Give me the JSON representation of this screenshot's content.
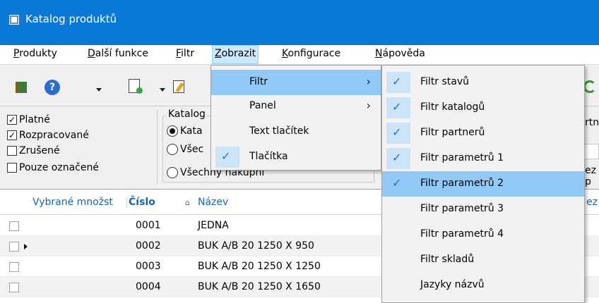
{
  "window": {
    "title": "Katalog produktů"
  },
  "menubar": {
    "items": [
      {
        "label": "Produkty",
        "accel": "P",
        "rest": "rodukty"
      },
      {
        "label": "Další funkce",
        "accel": "D",
        "rest": "alší funkce"
      },
      {
        "label": "Filtr",
        "accel": "F",
        "rest": "iltr"
      },
      {
        "label": "Zobrazit",
        "accel": "Z",
        "rest": "obrazit"
      },
      {
        "label": "Konfigurace",
        "accel": "K",
        "rest": "onfigurace"
      },
      {
        "label": "Nápověda",
        "accel": "N",
        "rest": "ápověda"
      }
    ],
    "active": "Zobrazit"
  },
  "toolbar": {
    "icons": [
      "exit-icon",
      "help-icon",
      "new-document-icon",
      "edit-document-icon",
      "refresh-icon"
    ],
    "help_glyph": "?"
  },
  "states_filter": {
    "items": [
      {
        "label": "Platné",
        "checked": true
      },
      {
        "label": "Rozpracované",
        "checked": true
      },
      {
        "label": "Zrušené",
        "checked": false
      },
      {
        "label": "Pouze označené",
        "checked": false
      }
    ],
    "check_glyph": "✓"
  },
  "catalog_filter": {
    "legend": "Katalog",
    "options": [
      {
        "label": "Kata",
        "selected": true
      },
      {
        "label": "Všec",
        "selected": false
      },
      {
        "label": "Všechny nákupní",
        "selected": false
      }
    ]
  },
  "right_panel": {
    "partner_fragment": "rtn",
    "ez_fragment": "ez p"
  },
  "grid": {
    "headers": {
      "selected_qty": "Vybrané množst",
      "number": "Číslo",
      "sort_glyph": "⌂",
      "name": "Název",
      "right_fragment": "ez"
    },
    "rows": [
      {
        "number": "0001",
        "name": "JEDNA",
        "current": false
      },
      {
        "number": "0002",
        "name": "BUK A/B 20 1250 X 950",
        "current": true
      },
      {
        "number": "0003",
        "name": "BUK A/B 20 1250 X 1250",
        "current": false
      },
      {
        "number": "0004",
        "name": "BUK A/B 20 1250 X 1650",
        "current": false
      }
    ]
  },
  "zobrazit_menu": {
    "items": [
      {
        "label": "Filtr",
        "submenu": true,
        "checked": false,
        "highlighted": true
      },
      {
        "label": "Panel",
        "submenu": true,
        "checked": false,
        "highlighted": false
      },
      {
        "label": "Text tlačítek",
        "submenu": false,
        "checked": false,
        "highlighted": false
      },
      {
        "label": "Tlačítka",
        "submenu": false,
        "checked": true,
        "highlighted": false
      }
    ],
    "chevron_glyph": "›"
  },
  "filtr_submenu": {
    "items": [
      {
        "label": "Filtr stavů",
        "checked": true,
        "highlighted": false
      },
      {
        "label": "Filtr katalogů",
        "checked": true,
        "highlighted": false
      },
      {
        "label": "Filtr partnerů",
        "checked": true,
        "highlighted": false
      },
      {
        "label": "Filtr parametrů 1",
        "checked": true,
        "highlighted": false
      },
      {
        "label": "Filtr parametrů 2",
        "checked": true,
        "highlighted": true
      },
      {
        "label": "Filtr parametrů 3",
        "checked": false,
        "highlighted": false
      },
      {
        "label": "Filtr parametrů 4",
        "checked": false,
        "highlighted": false
      },
      {
        "label": "Filtr skladů",
        "checked": false,
        "highlighted": false
      },
      {
        "label": "Jazyky názvů",
        "checked": false,
        "highlighted": false
      }
    ],
    "check_glyph": "✓"
  },
  "colors": {
    "titlebar": "#0a78d7",
    "menu_highlight": "#91c9f7",
    "check": "#1e73c8",
    "header_text": "#1565c0"
  }
}
